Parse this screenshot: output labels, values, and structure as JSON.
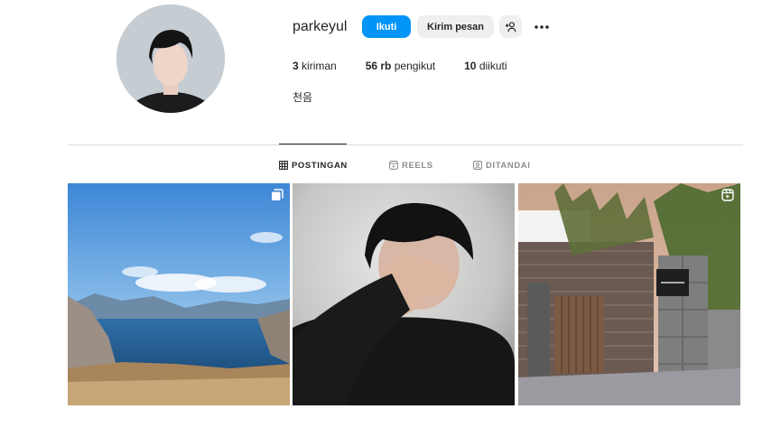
{
  "profile": {
    "username": "parkeyul",
    "follow_label": "Ikuti",
    "message_label": "Kirim pesan",
    "bio": "천음",
    "avatar_icon": "user-avatar",
    "add_user_icon": "add-user-icon",
    "more_icon": "more-options-icon"
  },
  "stats": {
    "posts_count": "3",
    "posts_label": "kiriman",
    "followers_count": "56 rb",
    "followers_label": "pengikut",
    "following_count": "10",
    "following_label": "diikuti"
  },
  "tabs": [
    {
      "label": "POSTINGAN",
      "icon": "grid-icon",
      "active": true
    },
    {
      "label": "REELS",
      "icon": "reels-icon",
      "active": false
    },
    {
      "label": "DITANDAI",
      "icon": "tagged-icon",
      "active": false
    }
  ],
  "posts": [
    {
      "subject": "mountain-crater-lake",
      "badge": "carousel-icon"
    },
    {
      "subject": "portrait-hand-over-face",
      "badge": ""
    },
    {
      "subject": "building-entrance-night",
      "badge": "reel-icon"
    }
  ],
  "colors": {
    "accent": "#0095f6",
    "secondary_button": "#efefef",
    "divider": "#dbdbdb",
    "text": "#262626",
    "muted": "#8e8e8e"
  }
}
